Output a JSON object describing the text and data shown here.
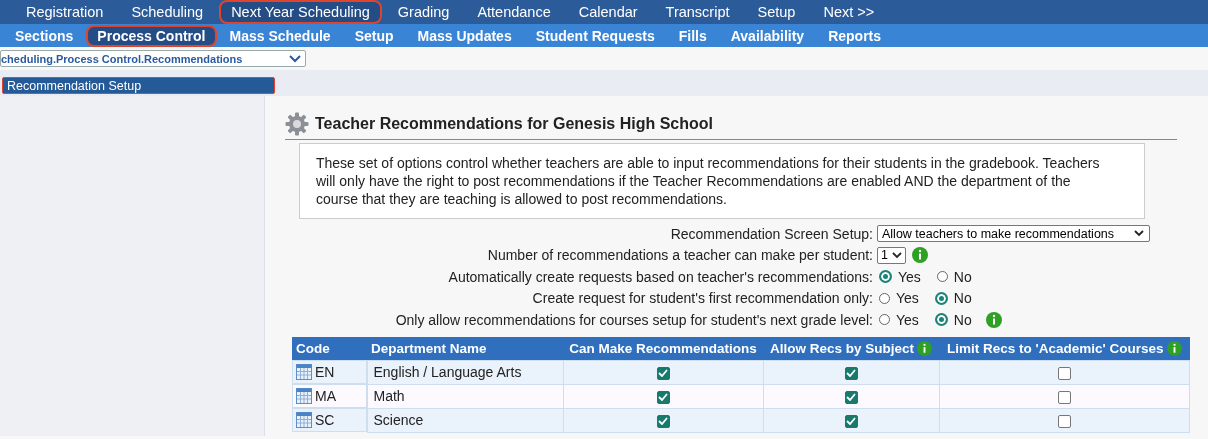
{
  "top_nav": [
    {
      "label": "Registration",
      "highlighted": false
    },
    {
      "label": "Scheduling",
      "highlighted": false
    },
    {
      "label": "Next Year Scheduling",
      "highlighted": true
    },
    {
      "label": "Grading",
      "highlighted": false
    },
    {
      "label": "Attendance",
      "highlighted": false
    },
    {
      "label": "Calendar",
      "highlighted": false
    },
    {
      "label": "Transcript",
      "highlighted": false
    },
    {
      "label": "Setup",
      "highlighted": false
    },
    {
      "label": "Next >>",
      "highlighted": false
    }
  ],
  "sub_nav": [
    {
      "label": "Sections",
      "highlighted": false
    },
    {
      "label": "Process Control",
      "highlighted": true
    },
    {
      "label": "Mass Schedule",
      "highlighted": false
    },
    {
      "label": "Setup",
      "highlighted": false
    },
    {
      "label": "Mass Updates",
      "highlighted": false
    },
    {
      "label": "Student Requests",
      "highlighted": false
    },
    {
      "label": "Fills",
      "highlighted": false
    },
    {
      "label": "Availability",
      "highlighted": false
    },
    {
      "label": "Reports",
      "highlighted": false
    }
  ],
  "breadcrumb_select": {
    "value": "cheduling.Process Control.Recommendations"
  },
  "page_tabs": [
    {
      "label": "Recommendation Setup",
      "selected": true,
      "highlighted": true
    }
  ],
  "section": {
    "title": "Teacher Recommendations for Genesis High School",
    "description": "These set of options control whether teachers are able to input recommendations for their students in the gradebook. Teachers will only have the right to post recommendations if the Teacher Recommendations are enabled AND the department of the course that they are teaching is allowed to post recommendations."
  },
  "settings": [
    {
      "kind": "select",
      "label": "Recommendation Screen Setup:",
      "value": "Allow teachers to make recommendations"
    },
    {
      "kind": "select",
      "label": "Number of recommendations a teacher can make per student:",
      "value": "1",
      "info": true
    },
    {
      "kind": "radio",
      "label": "Automatically create requests based on teacher's recommendations:",
      "options": [
        {
          "label": "Yes",
          "selected": true
        },
        {
          "label": "No",
          "selected": false
        }
      ]
    },
    {
      "kind": "radio",
      "label": "Create request for student's first recommendation only:",
      "options": [
        {
          "label": "Yes",
          "selected": false
        },
        {
          "label": "No",
          "selected": true
        }
      ]
    },
    {
      "kind": "radio",
      "label": "Only allow recommendations for courses setup for student's next grade level:",
      "options": [
        {
          "label": "Yes",
          "selected": false
        },
        {
          "label": "No",
          "selected": true
        }
      ],
      "info": true
    }
  ],
  "table": {
    "columns": [
      {
        "label": "Code",
        "info": false
      },
      {
        "label": "Department Name",
        "info": false
      },
      {
        "label": "Can Make Recommendations",
        "info": false
      },
      {
        "label": "Allow Recs by Subject",
        "info": true
      },
      {
        "label": "Limit Recs to 'Academic' Courses",
        "info": true
      }
    ],
    "rows": [
      {
        "code": "EN",
        "name": "English / Language Arts",
        "can_make": true,
        "by_subject": true,
        "academic_only": false
      },
      {
        "code": "MA",
        "name": "Math",
        "can_make": true,
        "by_subject": true,
        "academic_only": false
      },
      {
        "code": "SC",
        "name": "Science",
        "can_make": true,
        "by_subject": true,
        "academic_only": false
      }
    ]
  }
}
